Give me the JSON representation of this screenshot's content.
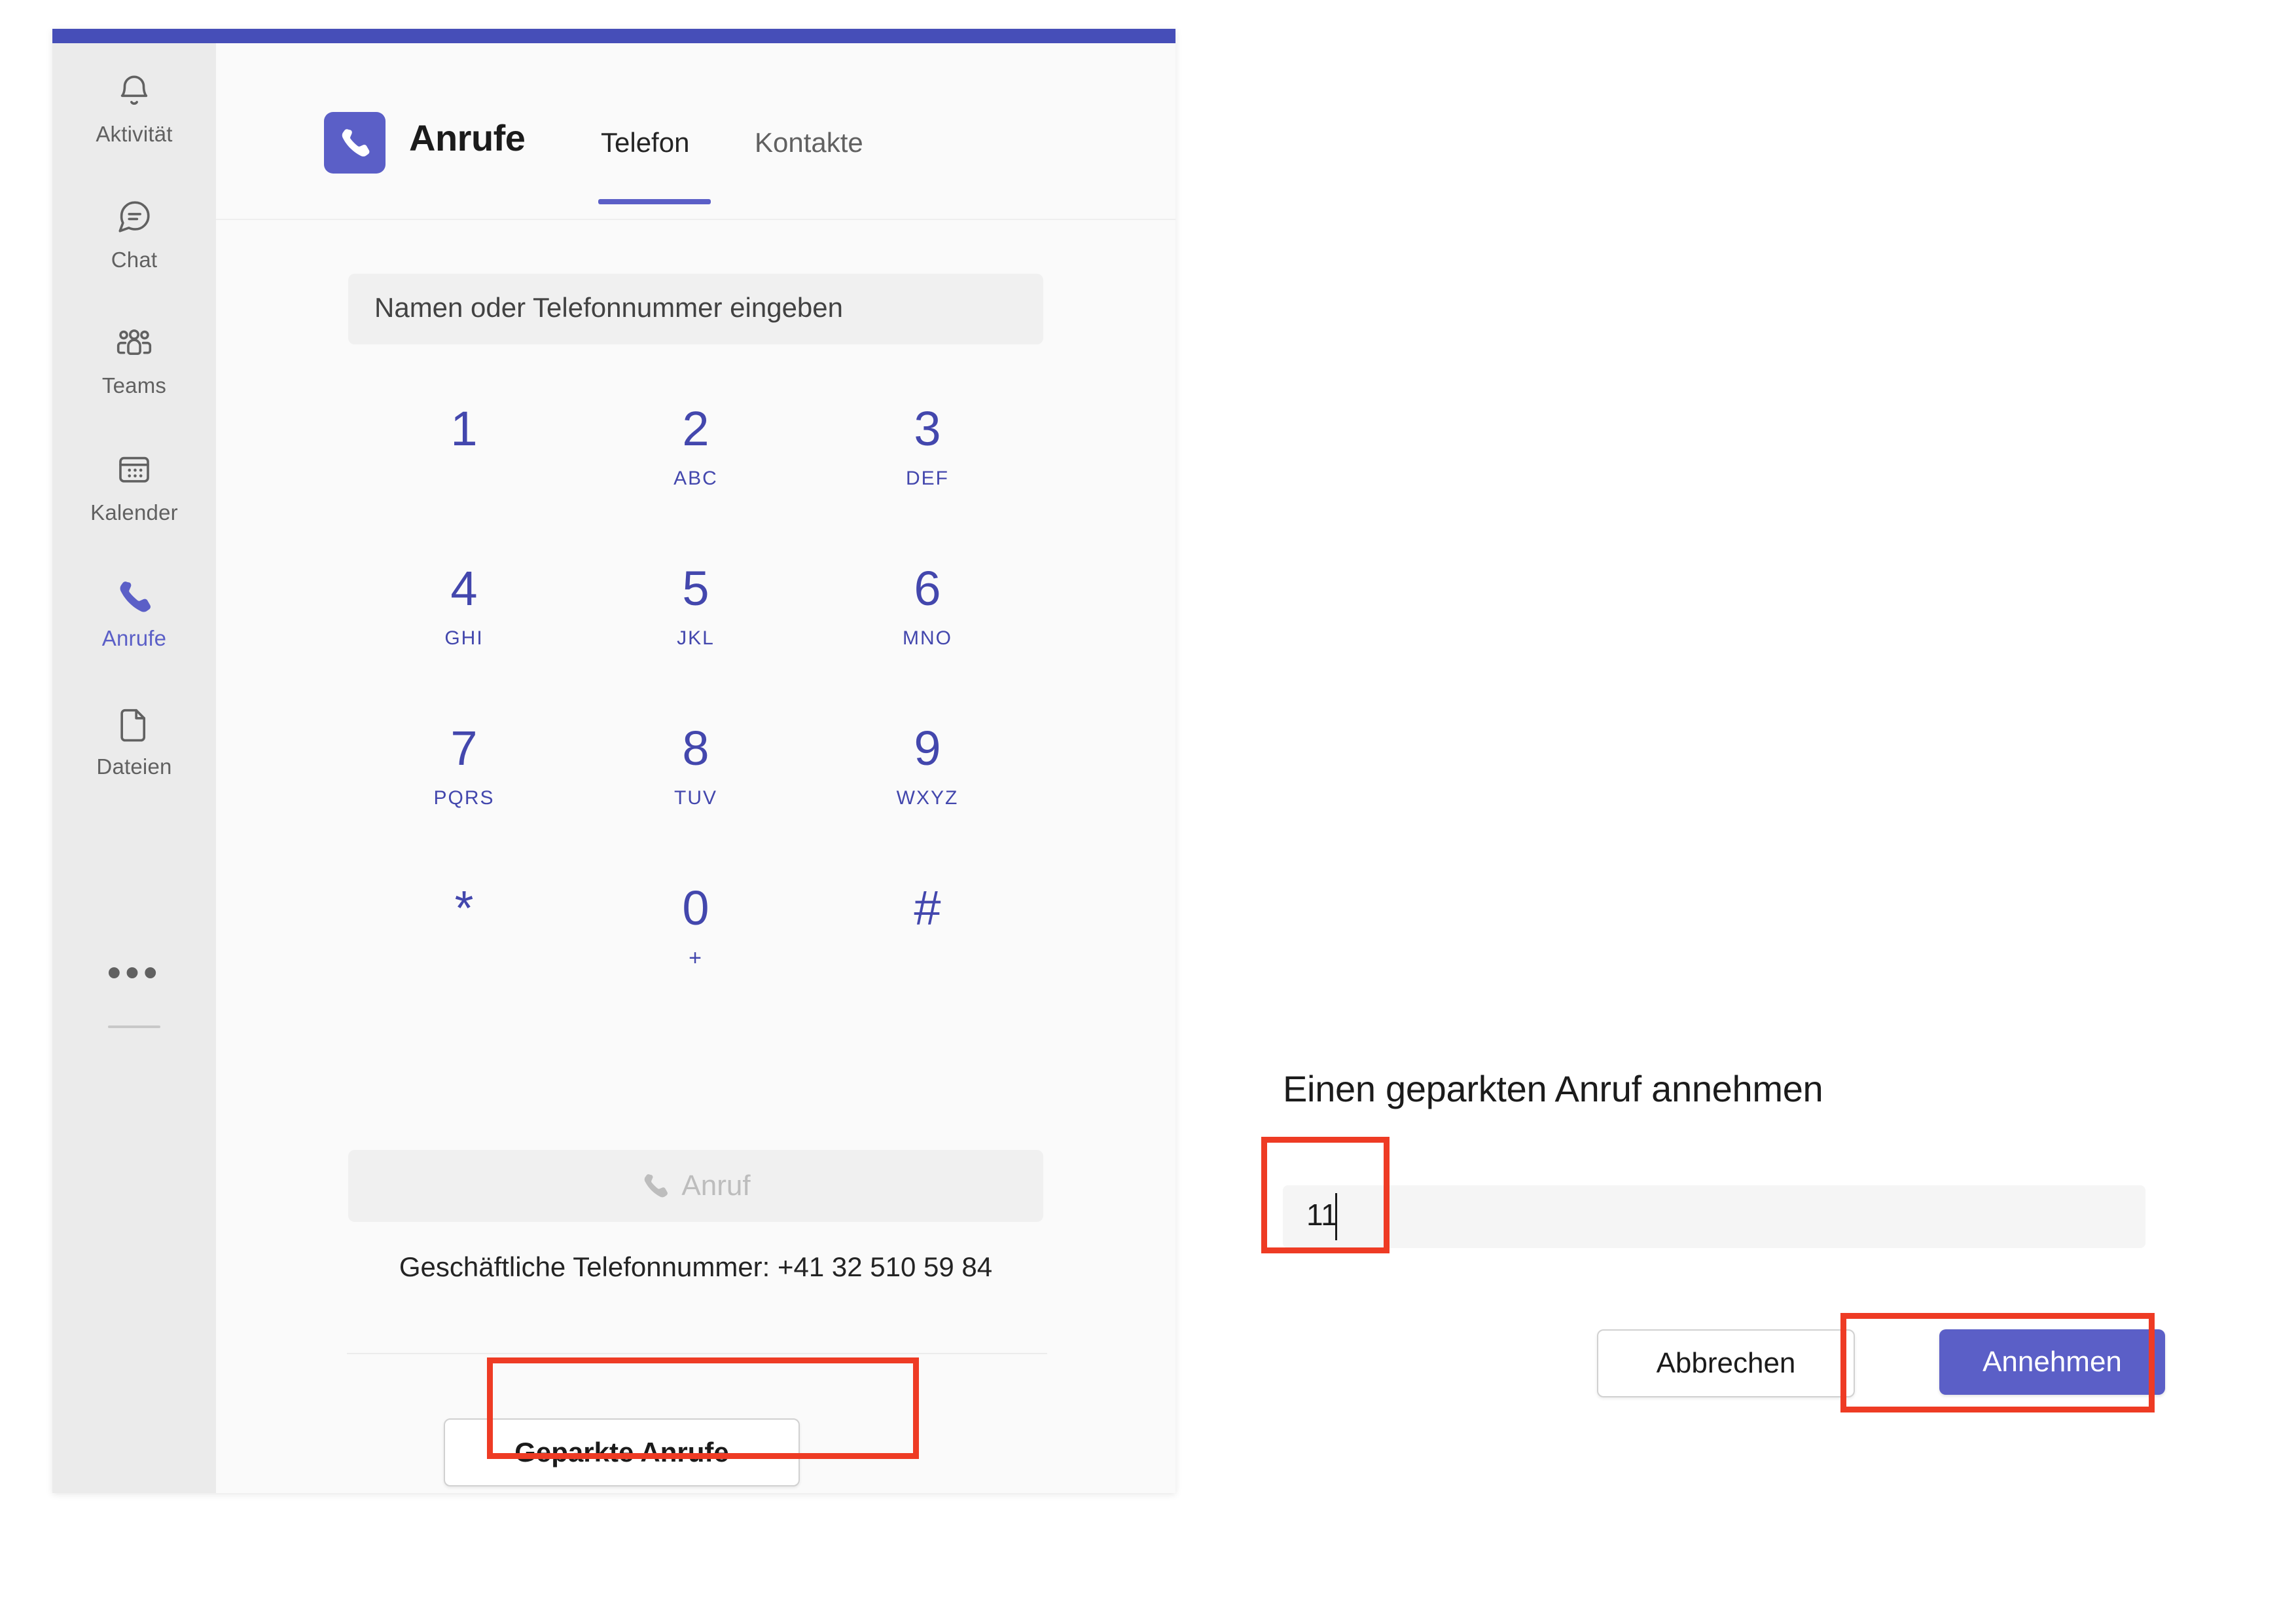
{
  "app": {
    "accent_color": "#464eb8",
    "brand_color": "#5b5fc7",
    "annotation_color": "#ee3b24"
  },
  "rail": {
    "items": [
      {
        "id": "aktivitaet",
        "label": "Aktivität",
        "icon": "bell-icon",
        "active": false
      },
      {
        "id": "chat",
        "label": "Chat",
        "icon": "chat-bubble-icon",
        "active": false
      },
      {
        "id": "teams",
        "label": "Teams",
        "icon": "people-group-icon",
        "active": false
      },
      {
        "id": "kalender",
        "label": "Kalender",
        "icon": "calendar-icon",
        "active": false
      },
      {
        "id": "anrufe",
        "label": "Anrufe",
        "icon": "phone-icon",
        "active": true
      },
      {
        "id": "dateien",
        "label": "Dateien",
        "icon": "file-icon",
        "active": false
      }
    ],
    "more_label": "•••"
  },
  "header": {
    "app_icon": "phone-icon",
    "title": "Anrufe",
    "tabs": [
      {
        "id": "telefon",
        "label": "Telefon",
        "selected": true
      },
      {
        "id": "kontakte",
        "label": "Kontakte",
        "selected": false
      }
    ]
  },
  "dialer": {
    "search_placeholder": "Namen oder Telefonnummer eingeben",
    "search_value": "",
    "keys": [
      {
        "num": "1",
        "sub": ""
      },
      {
        "num": "2",
        "sub": "ABC"
      },
      {
        "num": "3",
        "sub": "DEF"
      },
      {
        "num": "4",
        "sub": "GHI"
      },
      {
        "num": "5",
        "sub": "JKL"
      },
      {
        "num": "6",
        "sub": "MNO"
      },
      {
        "num": "7",
        "sub": "PQRS"
      },
      {
        "num": "8",
        "sub": "TUV"
      },
      {
        "num": "9",
        "sub": "WXYZ"
      },
      {
        "num": "*",
        "sub": ""
      },
      {
        "num": "0",
        "sub": "+"
      },
      {
        "num": "#",
        "sub": ""
      }
    ],
    "call_button_label": "Anruf",
    "call_button_icon": "phone-icon",
    "call_button_disabled": true,
    "business_number_line": "Geschäftliche Telefonnummer: +41 32 510 59 84",
    "parked_calls_label": "Geparkte Anrufe"
  },
  "pickup_dialog": {
    "title": "Einen geparkten Anruf annehmen",
    "code_value": "11",
    "code_placeholder": "",
    "cancel_label": "Abbrechen",
    "accept_label": "Annehmen"
  }
}
